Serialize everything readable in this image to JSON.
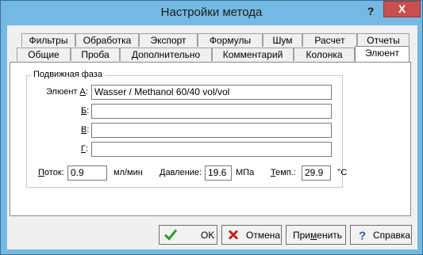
{
  "window": {
    "title": "Настройки метода",
    "help_glyph": "?",
    "close_glyph": "X"
  },
  "tabs_row1": [
    "Фильтры",
    "Обработка",
    "Экспорт",
    "Формулы",
    "Шум",
    "Расчет",
    "Отчеты"
  ],
  "tabs_row2": [
    "Общие",
    "Проба",
    "Дополнительно",
    "Комментарий",
    "Колонка",
    "Элюент"
  ],
  "active_tab": "Элюент",
  "mobile_phase": {
    "group_title": "Подвижная фаза",
    "eluent_a_label_prefix": "Элюент ",
    "eluent_a_label_key": "А",
    "eluent_a_label_suffix": ":",
    "eluent_a_value": "Wasser / Methanol 60/40 vol/vol",
    "eluent_b_label_key": "Б",
    "eluent_b_value": "",
    "eluent_v_label_key": "В",
    "eluent_v_value": "",
    "eluent_g_label_key": "Г",
    "eluent_g_value": "",
    "colon": ":"
  },
  "params": {
    "flow_label_key": "П",
    "flow_label_rest": "оток:",
    "flow_value": "0.9",
    "flow_unit": "мл/мин",
    "pressure_label_key": "Д",
    "pressure_label_rest": "авление:",
    "pressure_value": "19.6",
    "pressure_unit": "МПа",
    "temp_label_key": "Т",
    "temp_label_rest": "емп.:",
    "temp_value": "29.9",
    "temp_unit": "°C"
  },
  "buttons": {
    "ok": "OK",
    "cancel": "Отмена",
    "apply_prefix": "При",
    "apply_key": "м",
    "apply_suffix": "енить",
    "help": "Справка"
  },
  "colors": {
    "frame": "#74b9e4",
    "close": "#c7504f",
    "ok_check": "#2f9a2f",
    "cancel_x": "#c8201a",
    "help_q": "#2a5fb0"
  }
}
